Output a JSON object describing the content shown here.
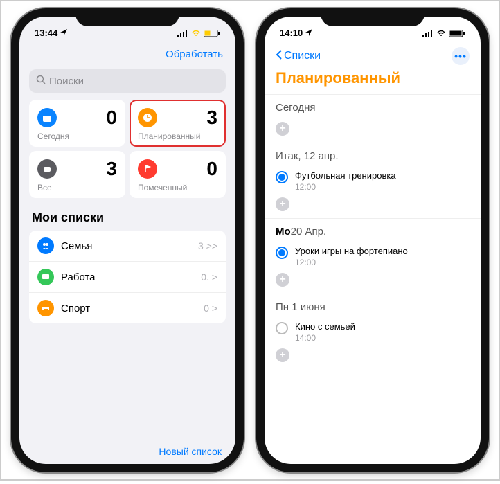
{
  "phone1": {
    "status_time": "13:44",
    "top_link": "Обработать",
    "search_placeholder": "Поиски",
    "cards": {
      "today": {
        "count": "0",
        "label": "Сегодня"
      },
      "scheduled": {
        "count": "3",
        "label": "Планированный"
      },
      "all": {
        "count": "3",
        "label": "Все"
      },
      "flagged": {
        "count": "0",
        "label": "Помеченный"
      }
    },
    "mylists_title": "Мои списки",
    "lists": [
      {
        "name": "Семья",
        "meta": "3 >>"
      },
      {
        "name": "Работа",
        "meta": "0. >"
      },
      {
        "name": "Спорт",
        "meta": "0 >"
      }
    ],
    "new_list": "Новый список"
  },
  "phone2": {
    "status_time": "14:10",
    "back_label": "Списки",
    "title": "Планированный",
    "sections": [
      {
        "title_prefix": "",
        "title": "Сегодня",
        "items": []
      },
      {
        "title_prefix": "",
        "title": "Итак, 12 апр.",
        "items": [
          {
            "text": "Футбольная тренировка",
            "time": "12:00",
            "active": true
          }
        ]
      },
      {
        "title_prefix": "Mo",
        "title": "20 Апр.",
        "items": [
          {
            "text": "Уроки игры на фортепиано",
            "time": "12:00",
            "active": true
          }
        ]
      },
      {
        "title_prefix": "",
        "title": "Пн 1 июня",
        "items": [
          {
            "text": "Кино с семьей",
            "time": "14:00",
            "active": false
          }
        ]
      }
    ]
  }
}
